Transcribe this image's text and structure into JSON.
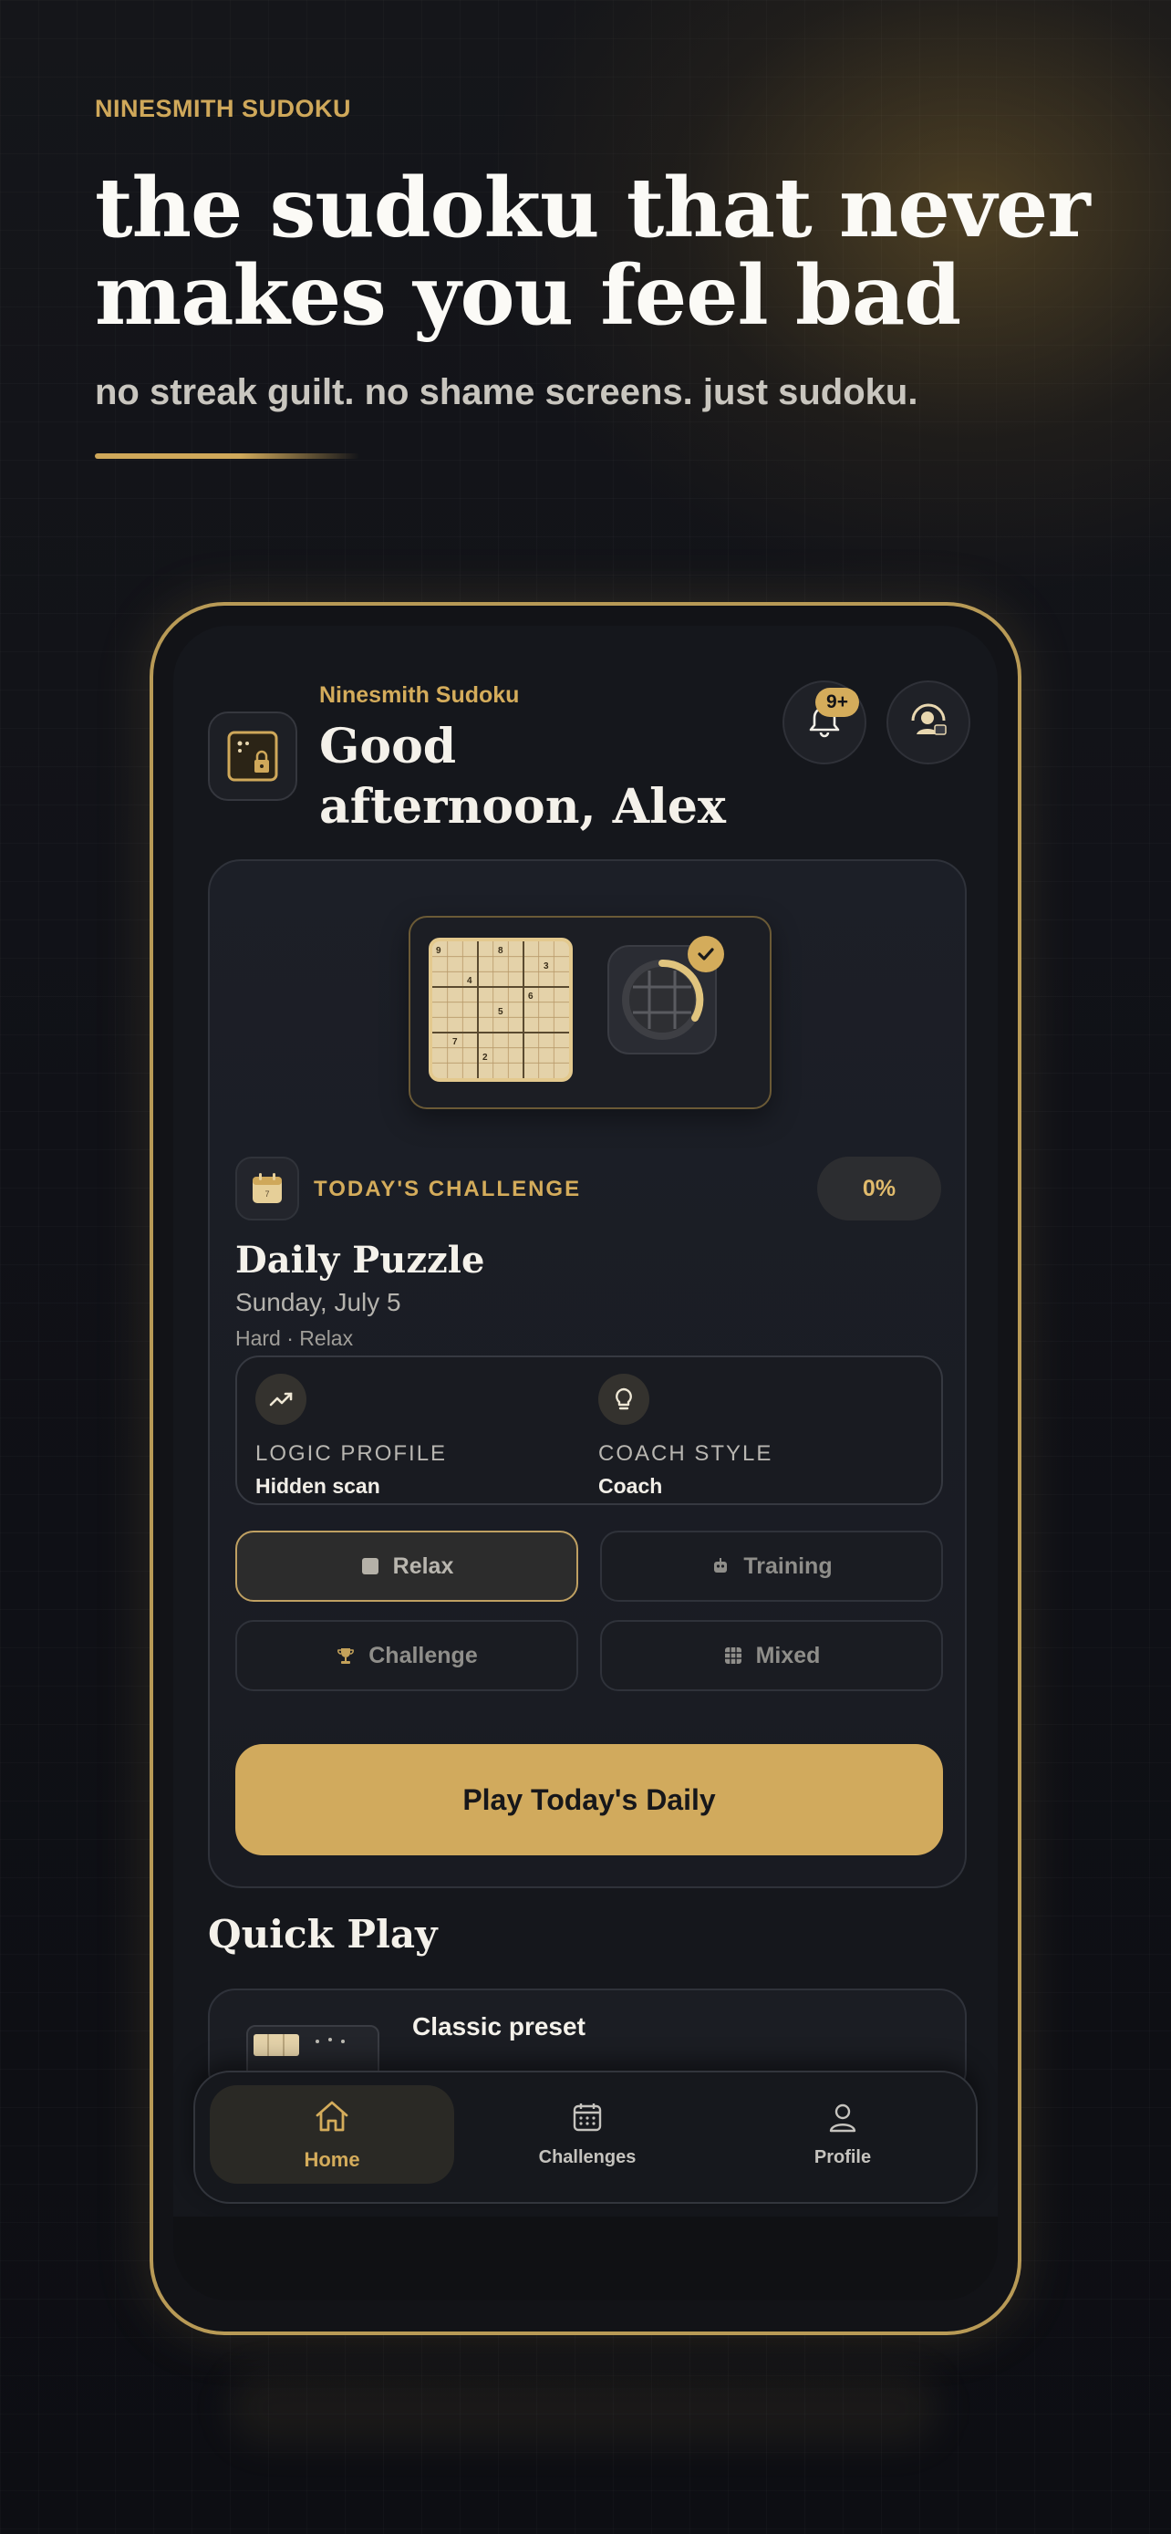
{
  "marketing": {
    "brand": "NINESMITH SUDOKU",
    "headline": "the sudoku that never makes you feel bad",
    "subheadline": "no streak guilt. no shame screens. just sudoku."
  },
  "header": {
    "app_name": "Ninesmith Sudoku",
    "greeting": "Good afternoon, Alex",
    "notification_badge": "9+",
    "notification_icon": "bell-icon",
    "profile_icon": "user-avatar-icon"
  },
  "challenge": {
    "label": "TODAY'S CHALLENGE",
    "progress": "0%",
    "title": "Daily Puzzle",
    "date": "Sunday, July 5",
    "meta": "Hard · Relax"
  },
  "profile": {
    "logic_label": "LOGIC PROFILE",
    "logic_value": "Hidden scan",
    "coach_label": "COACH STYLE",
    "coach_value": "Coach"
  },
  "modes": [
    {
      "label": "Relax",
      "icon": "board-icon",
      "active": true
    },
    {
      "label": "Training",
      "icon": "robot-icon",
      "active": false
    },
    {
      "label": "Challenge",
      "icon": "trophy-icon",
      "active": false
    },
    {
      "label": "Mixed",
      "icon": "grid-icon",
      "active": false
    }
  ],
  "play_button": "Play Today's Daily",
  "quick_play": {
    "title": "Quick Play",
    "preset": "Classic preset"
  },
  "tabs": [
    {
      "label": "Home",
      "icon": "home-icon",
      "active": true
    },
    {
      "label": "Challenges",
      "icon": "calendar-icon",
      "active": false
    },
    {
      "label": "Profile",
      "icon": "person-icon",
      "active": false
    }
  ],
  "colors": {
    "accent": "#d1aa5d",
    "background": "#101117",
    "card": "#1c1f27"
  }
}
